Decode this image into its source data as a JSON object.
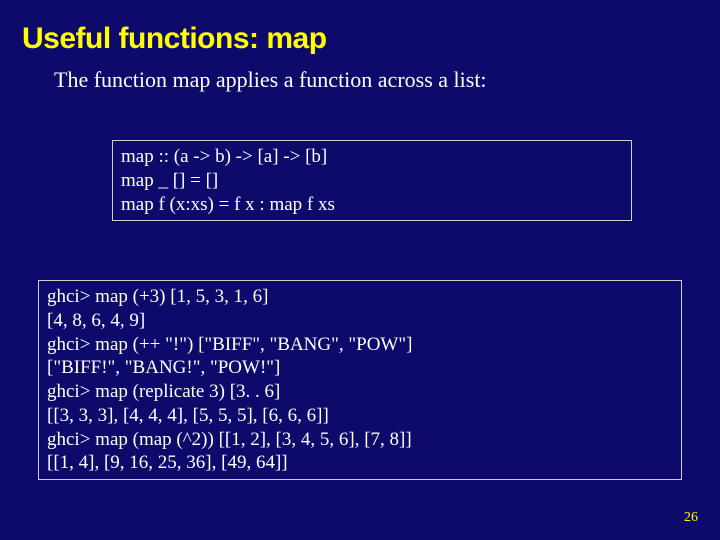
{
  "title": "Useful functions: map",
  "intro": "The function map applies a function across a list:",
  "definition": {
    "l1": "map :: (a -> b) -> [a] -> [b]",
    "l2": "map _ [] = []",
    "l3": "map f (x:xs) = f x : map f xs"
  },
  "session": {
    "l1": "ghci> map (+3) [1, 5, 3, 1, 6]",
    "l2": "[4, 8, 6, 4, 9]",
    "l3": "ghci> map (++ \"!\") [\"BIFF\", \"BANG\", \"POW\"]",
    "l4": "[\"BIFF!\", \"BANG!\", \"POW!\"]",
    "l5": "ghci> map (replicate 3) [3. . 6]",
    "l6": "[[3, 3, 3], [4, 4, 4], [5, 5, 5], [6, 6, 6]]",
    "l7": "ghci> map (map (^2)) [[1, 2], [3, 4, 5, 6], [7, 8]]",
    "l8": "[[1, 4], [9, 16, 25, 36], [49, 64]]"
  },
  "page_number": "26"
}
